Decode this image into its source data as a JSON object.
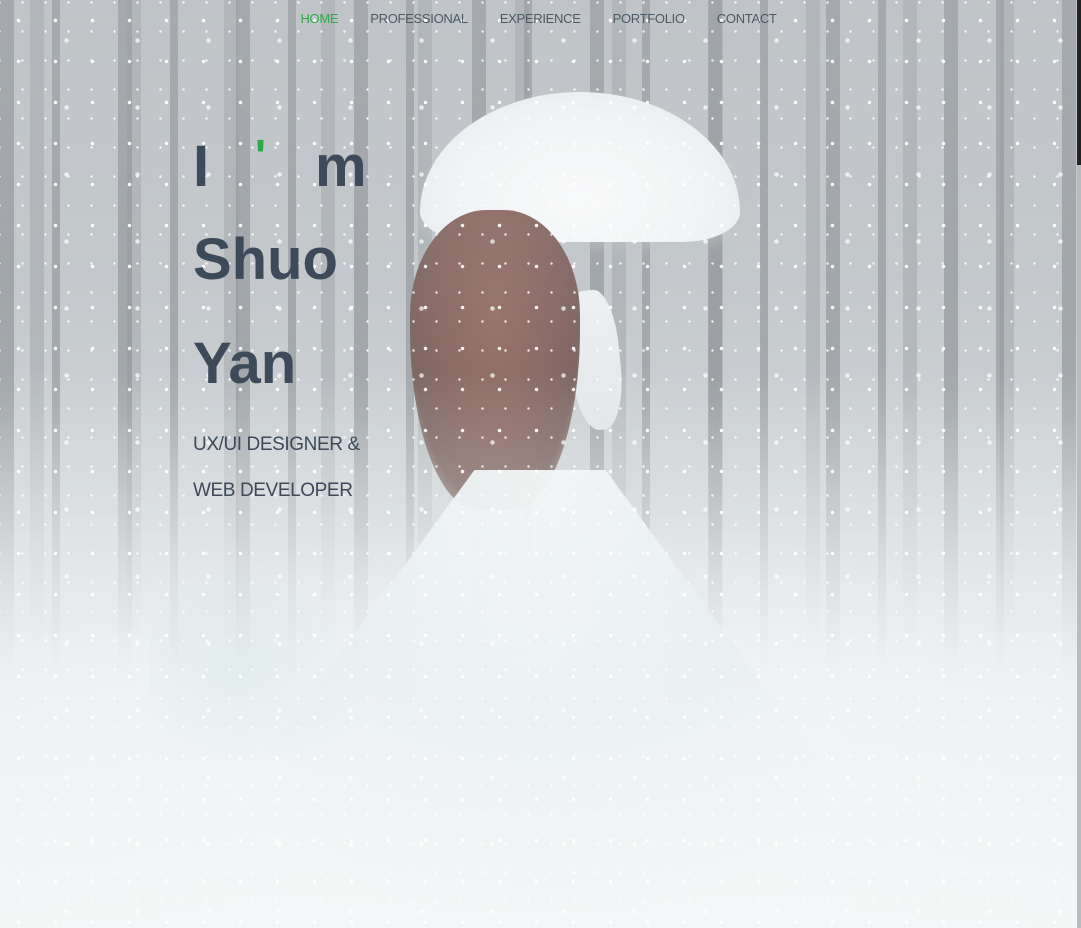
{
  "nav": {
    "items": [
      {
        "label": "HOME",
        "active": true
      },
      {
        "label": "PROFESSIONAL",
        "active": false
      },
      {
        "label": "EXPERIENCE",
        "active": false
      },
      {
        "label": "PORTFOLIO",
        "active": false
      },
      {
        "label": "CONTACT",
        "active": false
      }
    ]
  },
  "hero": {
    "greeting": {
      "i": "I",
      "apostrophe": "'",
      "m": "m"
    },
    "first_name": "Shuo",
    "last_name": "Yan",
    "subtitle": "UX/UI DESIGNER & WEB DEVELOPER"
  },
  "colors": {
    "accent": "#2ea84a",
    "text": "#3c4a5a",
    "nav_text": "#4c5966"
  },
  "background": {
    "image": "snowy-forest-woman-umbrella-photo"
  }
}
